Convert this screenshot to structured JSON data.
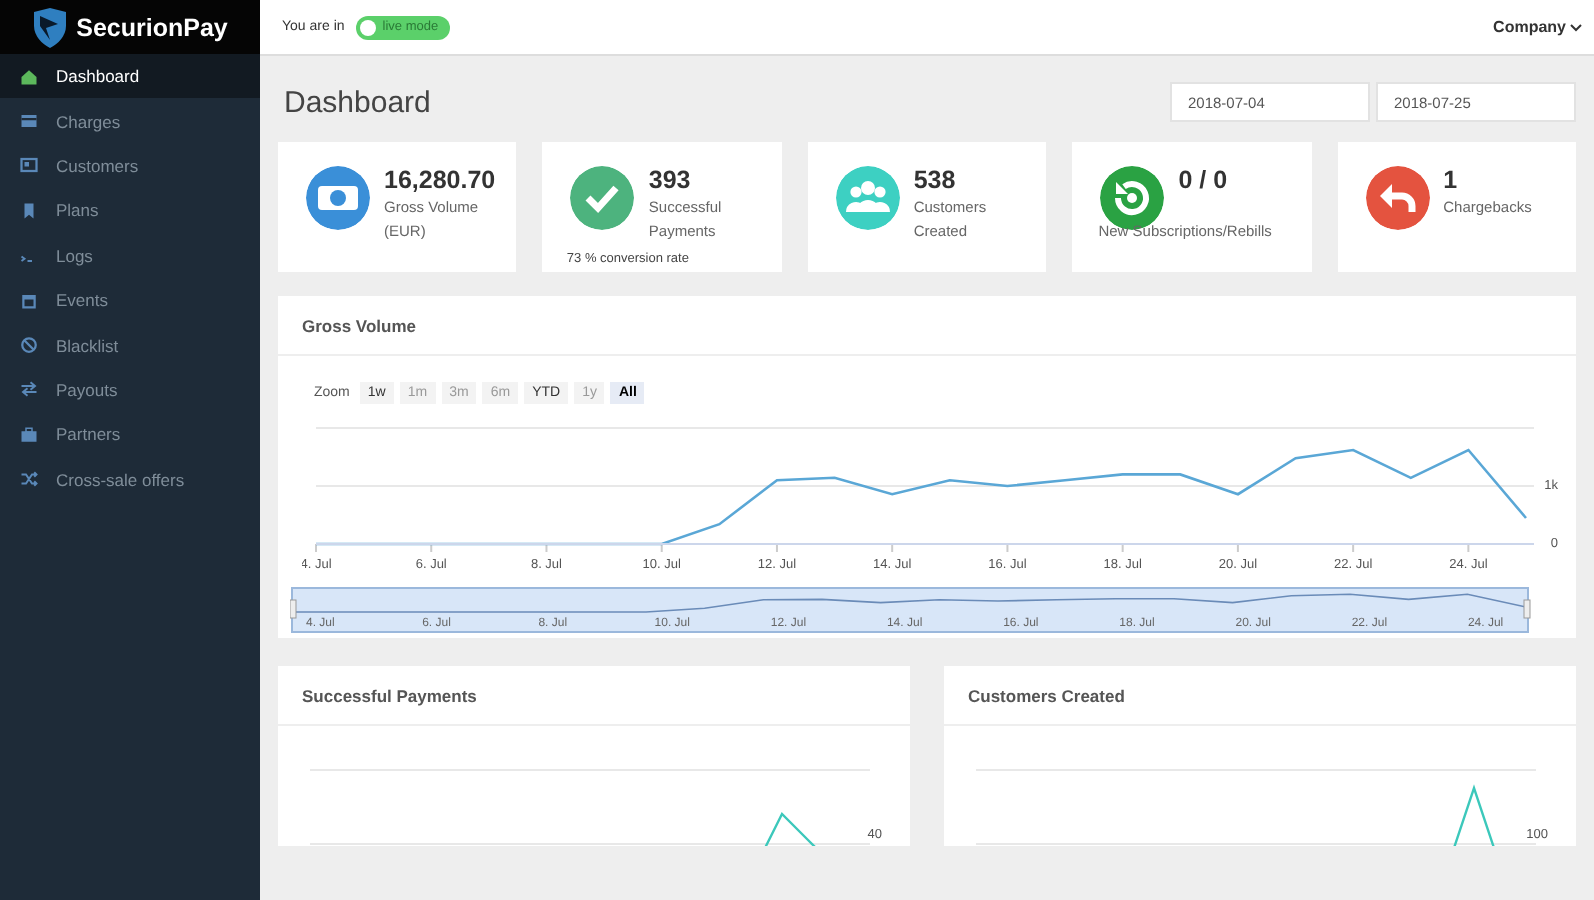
{
  "brand": {
    "name": "SecurionPay"
  },
  "sidebar": {
    "items": [
      {
        "label": "Dashboard",
        "selected": true
      },
      {
        "label": "Charges",
        "selected": false
      },
      {
        "label": "Customers",
        "selected": false
      },
      {
        "label": "Plans",
        "selected": false
      },
      {
        "label": "Logs",
        "selected": false
      },
      {
        "label": "Events",
        "selected": false
      },
      {
        "label": "Blacklist",
        "selected": false
      },
      {
        "label": "Payouts",
        "selected": false
      },
      {
        "label": "Partners",
        "selected": false
      },
      {
        "label": "Cross-sale offers",
        "selected": false
      }
    ]
  },
  "topbar": {
    "mode_prefix": "You are in",
    "mode_toggle": {
      "label": "live mode",
      "on": true
    },
    "account_menu": "Company"
  },
  "page": {
    "title": "Dashboard",
    "date_from": "2018-07-04",
    "date_to": "2018-07-25"
  },
  "stats": [
    {
      "value": "16,280.70",
      "label": "Gross Volume (EUR)",
      "color": "#3a8fd8"
    },
    {
      "value": "393",
      "label": "Successful Payments",
      "note": "73 % conversion rate",
      "color": "#4db37e"
    },
    {
      "value": "538",
      "label": "Customers Created",
      "color": "#3dd0c2"
    },
    {
      "value": "0 / 0",
      "label": "New Subscriptions/Rebills",
      "color": "#2aa243"
    },
    {
      "value": "1",
      "label": "Chargebacks",
      "color": "#e4533f"
    }
  ],
  "gross_volume": {
    "title": "Gross Volume",
    "zoom_label": "Zoom",
    "zoom_buttons": [
      {
        "label": "1w",
        "selected": false,
        "disabled": false
      },
      {
        "label": "1m",
        "selected": false,
        "disabled": true
      },
      {
        "label": "3m",
        "selected": false,
        "disabled": true
      },
      {
        "label": "6m",
        "selected": false,
        "disabled": true
      },
      {
        "label": "YTD",
        "selected": false,
        "disabled": false
      },
      {
        "label": "1y",
        "selected": false,
        "disabled": true
      },
      {
        "label": "All",
        "selected": true,
        "disabled": false
      }
    ],
    "chart_data": {
      "type": "line",
      "categories": [
        "4. Jul",
        null,
        "6. Jul",
        null,
        "8. Jul",
        null,
        "10. Jul",
        null,
        "12. Jul",
        null,
        "14. Jul",
        null,
        "16. Jul",
        null,
        "18. Jul",
        null,
        "20. Jul",
        null,
        "22. Jul",
        null,
        "24. Jul",
        null
      ],
      "series": [
        {
          "color": "#5aa7d6",
          "values": [
            0,
            0,
            0,
            0,
            0,
            0,
            0,
            340,
            1100,
            1140,
            860,
            1100,
            1000,
            1100,
            1200,
            1200,
            860,
            1480,
            1620,
            1140,
            1620,
            450
          ]
        }
      ],
      "ylim": [
        0,
        2000
      ],
      "yticks": [
        {
          "value": 0,
          "label": "0"
        },
        {
          "value": 1000,
          "label": "1k"
        }
      ]
    },
    "navigator_labels": [
      "4. Jul",
      "6. Jul",
      "8. Jul",
      "10. Jul",
      "12. Jul",
      "14. Jul",
      "16. Jul",
      "18. Jul",
      "20. Jul",
      "22. Jul",
      "24. Jul"
    ]
  },
  "bottom_panels": [
    {
      "title": "Successful Payments",
      "axis_label": "40"
    },
    {
      "title": "Customers Created",
      "axis_label": "100"
    }
  ]
}
